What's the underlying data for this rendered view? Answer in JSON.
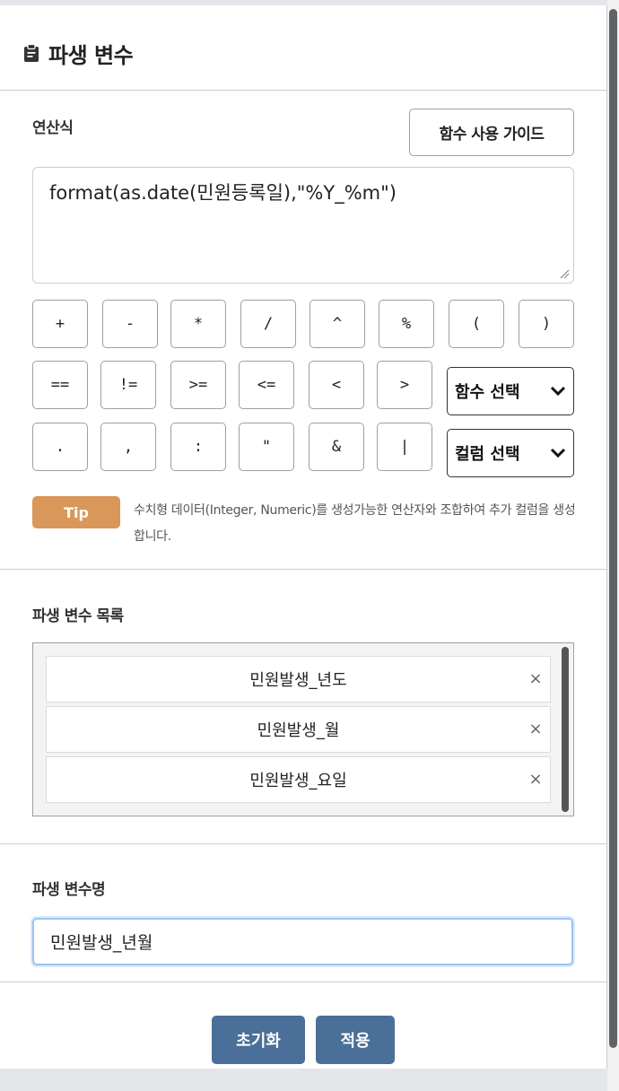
{
  "dialog": {
    "title": "파생 변수",
    "title_icon": "clipboard-icon"
  },
  "formula_section": {
    "label": "연산식",
    "guide_button": "함수 사용 가이드",
    "expression": "format(as.date(민원등록일),\"%Y_%m\")"
  },
  "operators": {
    "row1": [
      "+",
      "-",
      "*",
      "/",
      "^",
      "%",
      "(",
      ")"
    ],
    "row2": [
      "==",
      "!=",
      ">=",
      "<=",
      "<",
      ">"
    ],
    "row3": [
      ".",
      ",",
      ":",
      "\"",
      "&",
      "|"
    ]
  },
  "selects": {
    "function_select": "함수 선택",
    "column_select": "컬럼 선택"
  },
  "tip": {
    "badge": "Tip",
    "text": "수치형 데이터(Integer, Numeric)를 생성가능한 연산자와 조합하여 추가 컬럼을 생성합니다."
  },
  "derived_list": {
    "label": "파생 변수 목록",
    "items": [
      "민원발생_년도",
      "민원발생_월",
      "민원발생_요일"
    ],
    "remove_symbol": "×"
  },
  "derived_name": {
    "label": "파생 변수명",
    "value": "민원발생_년월"
  },
  "actions": {
    "reset": "초기화",
    "apply": "적용"
  },
  "colors": {
    "tip_badge": "#d9975a",
    "action_button": "#4a6f98",
    "input_focus": "#9cc3f0"
  }
}
